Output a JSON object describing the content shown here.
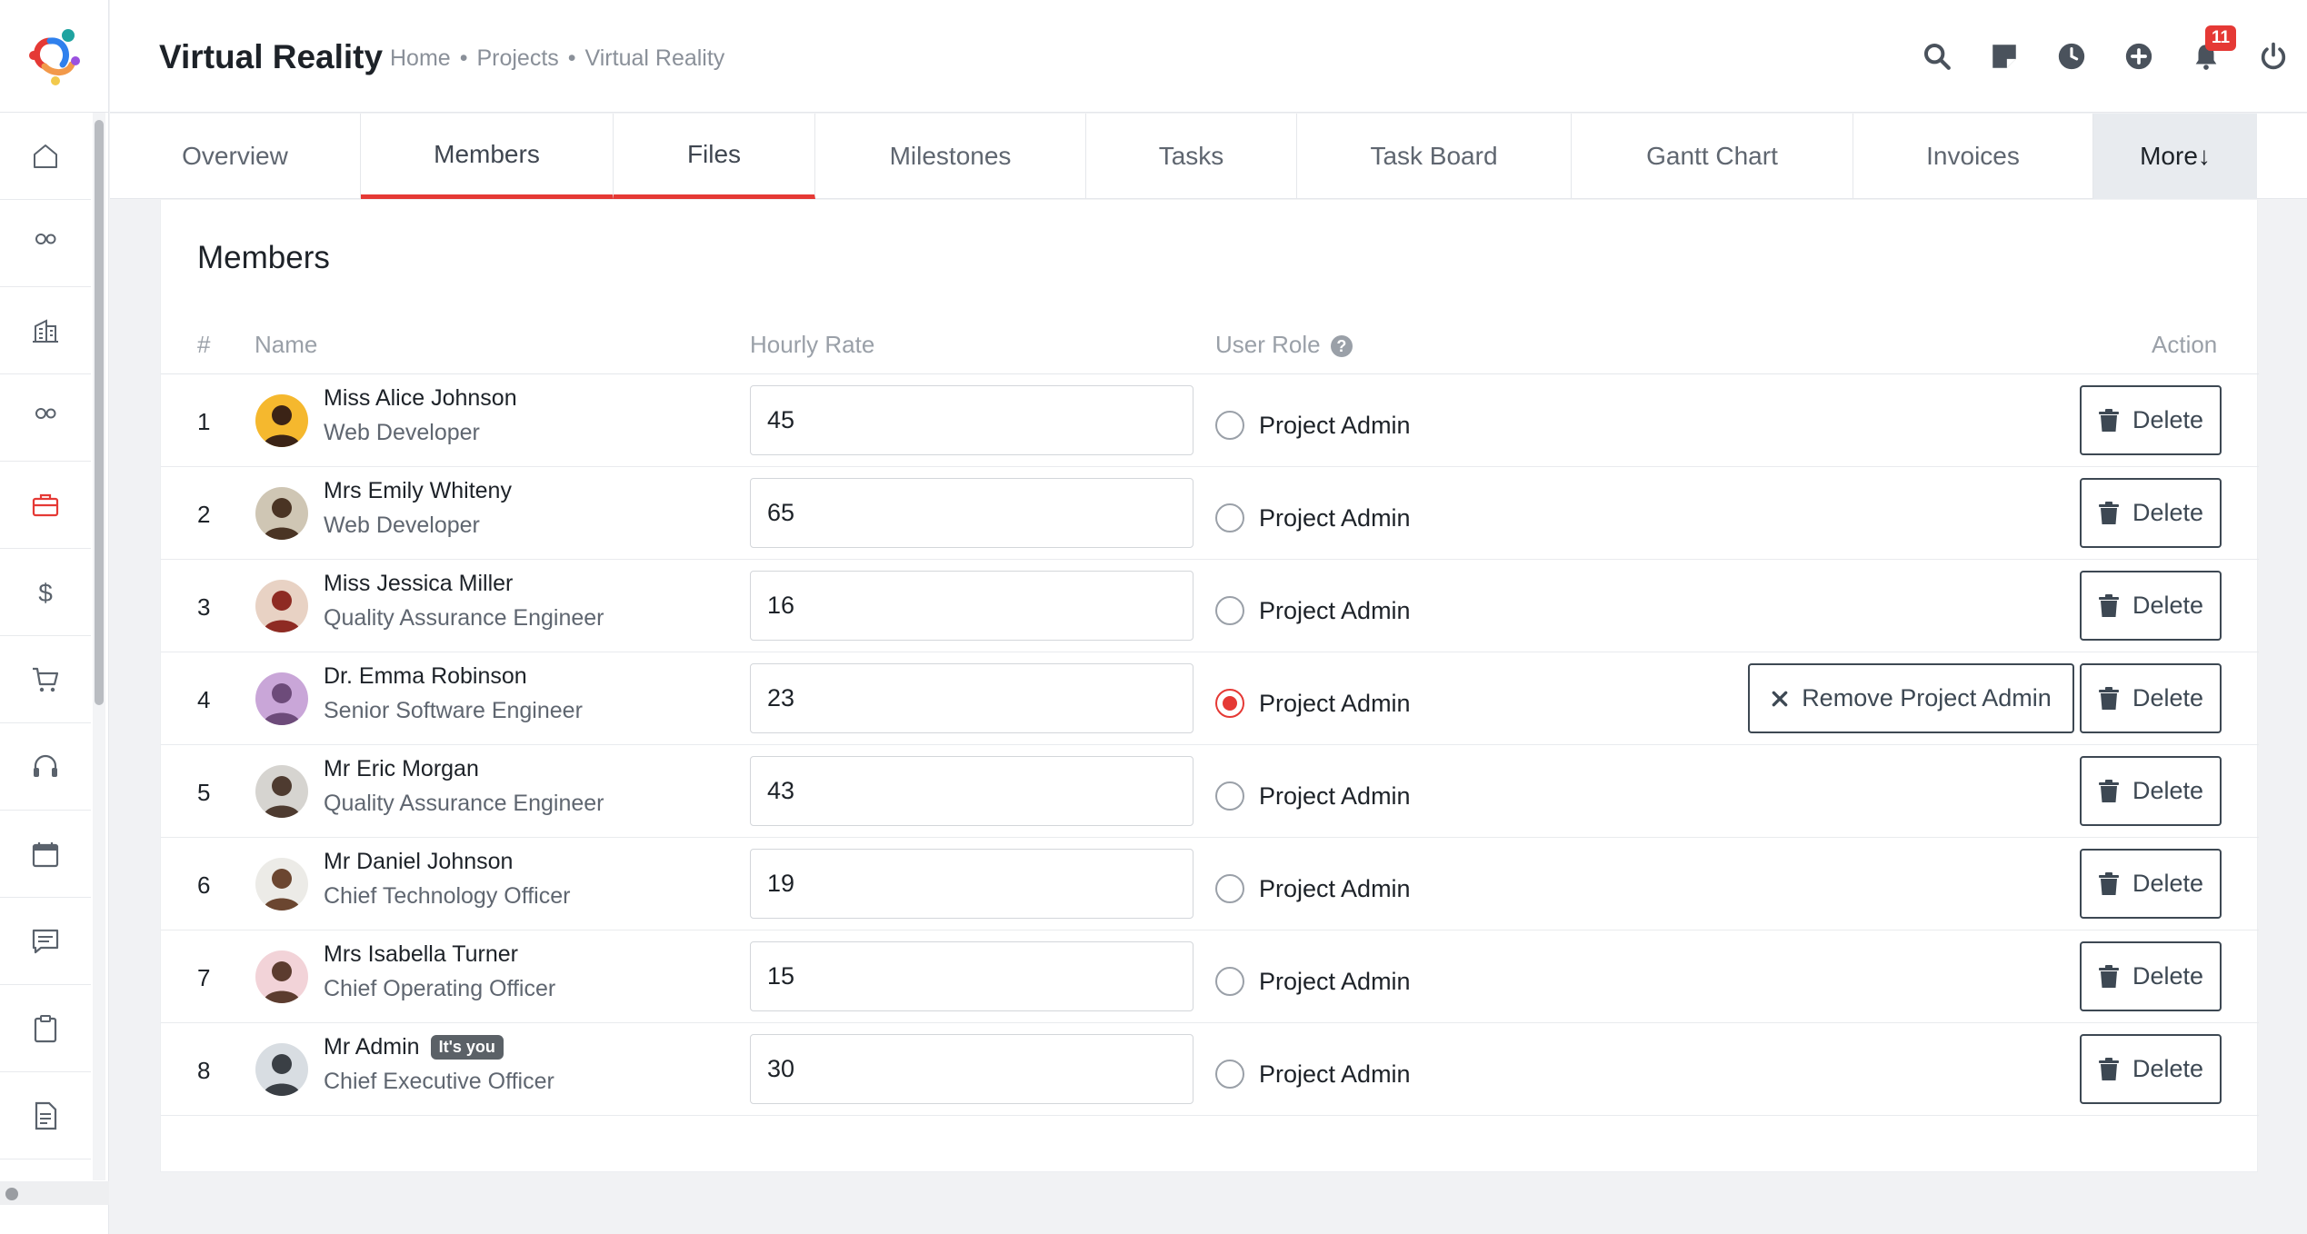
{
  "header": {
    "title": "Virtual Reality",
    "breadcrumb": [
      "Home",
      "Projects",
      "Virtual Reality"
    ],
    "notification_count": "11",
    "icons": [
      "search-icon",
      "sticky-note-icon",
      "clock-icon",
      "plus-circle-icon",
      "bell-icon",
      "power-icon"
    ]
  },
  "sidebar": {
    "items": [
      "home-icon",
      "users-icon",
      "building-icon",
      "team-icon",
      "briefcase-icon",
      "dollar-icon",
      "cart-icon",
      "headset-icon",
      "calendar-icon",
      "message-icon",
      "clipboard-icon",
      "document-icon"
    ],
    "active_index": 4
  },
  "tabs": [
    "Overview",
    "Members",
    "Files",
    "Milestones",
    "Tasks",
    "Task Board",
    "Gantt Chart",
    "Invoices",
    "More↓"
  ],
  "active_tab": "Members",
  "members": {
    "title": "Members",
    "columns": {
      "num": "#",
      "name": "Name",
      "rate": "Hourly Rate",
      "role": "User Role",
      "action": "Action"
    },
    "project_admin_label": "Project Admin",
    "delete_label": "Delete",
    "remove_admin_label": "Remove Project Admin",
    "you_badge": "It's you",
    "rows": [
      {
        "num": "1",
        "name": "Miss Alice Johnson",
        "role": "Web Developer",
        "rate": "45",
        "is_admin": false
      },
      {
        "num": "2",
        "name": "Mrs Emily Whiteny",
        "role": "Web Developer",
        "rate": "65",
        "is_admin": false
      },
      {
        "num": "3",
        "name": "Miss Jessica Miller",
        "role": "Quality Assurance Engineer",
        "rate": "16",
        "is_admin": false
      },
      {
        "num": "4",
        "name": "Dr. Emma Robinson",
        "role": "Senior Software Engineer",
        "rate": "23",
        "is_admin": true
      },
      {
        "num": "5",
        "name": "Mr Eric Morgan",
        "role": "Quality Assurance Engineer",
        "rate": "43",
        "is_admin": false
      },
      {
        "num": "6",
        "name": "Mr Daniel Johnson",
        "role": "Chief Technology Officer",
        "rate": "19",
        "is_admin": false
      },
      {
        "num": "7",
        "name": "Mrs Isabella Turner",
        "role": "Chief Operating Officer",
        "rate": "15",
        "is_admin": false
      },
      {
        "num": "8",
        "name": "Mr Admin",
        "role": "Chief Executive Officer",
        "rate": "30",
        "is_admin": false,
        "is_you": true
      }
    ]
  },
  "colors": {
    "accent": "#e53935",
    "text": "#1d2228",
    "muted": "#5f6670"
  }
}
